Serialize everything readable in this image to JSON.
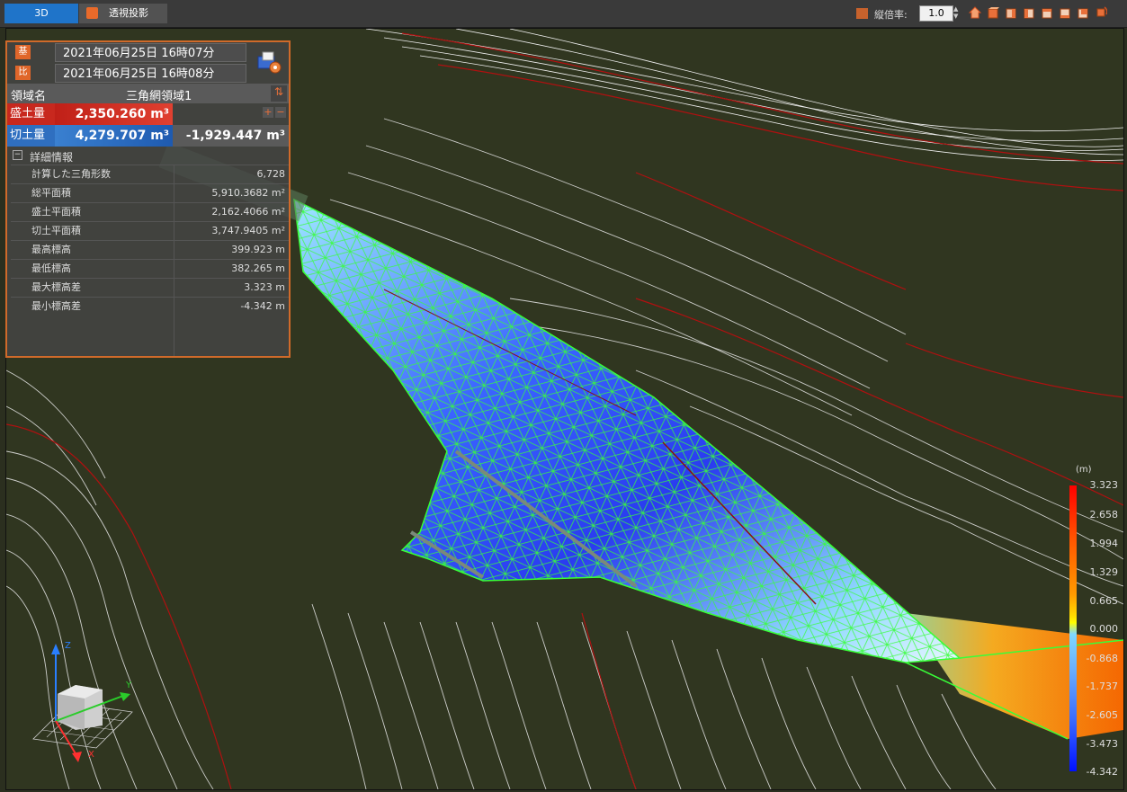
{
  "tabs": [
    {
      "label": "3D",
      "active": true
    },
    {
      "label": "透視投影",
      "active": false
    }
  ],
  "toolbar": {
    "vertical_ratio_label": "縦倍率:",
    "vertical_ratio_value": "1.0",
    "view_icons": [
      "home-icon",
      "front-view-icon",
      "back-view-icon",
      "left-view-icon",
      "right-view-icon",
      "top-view-icon",
      "bottom-view-icon",
      "rotate-view-icon"
    ]
  },
  "panel": {
    "base_badge": "基",
    "base_datetime": "2021年06月25日 16時07分",
    "compare_badge": "比",
    "compare_datetime": "2021年06月25日 16時08分",
    "region_label": "領域名",
    "region_value": "三角網領域1",
    "fill_label": "盛土量",
    "fill_value": "2,350.260 m³",
    "cut_label": "切土量",
    "cut_value": "4,279.707 m³",
    "net_value": "-1,929.447 m³",
    "detail_header": "詳細情報",
    "details": [
      {
        "key": "計算した三角形数",
        "value": "6,728"
      },
      {
        "key": "総平面積",
        "value": "5,910.3682 m²"
      },
      {
        "key": "盛土平面積",
        "value": "2,162.4066 m²"
      },
      {
        "key": "切土平面積",
        "value": "3,747.9405 m²"
      },
      {
        "key": "最高標高",
        "value": "399.923 m"
      },
      {
        "key": "最低標高",
        "value": "382.265 m"
      },
      {
        "key": "最大標高差",
        "value": "3.323 m"
      },
      {
        "key": "最小標高差",
        "value": "-4.342 m"
      }
    ]
  },
  "legend": {
    "unit": "(m)",
    "ticks": [
      "3.323",
      "2.658",
      "1.994",
      "1.329",
      "0.665",
      "0.000",
      "-0.868",
      "-1.737",
      "-2.605",
      "-3.473",
      "-4.342"
    ]
  },
  "axes": {
    "z": "Z",
    "y": "Y",
    "x": "X"
  },
  "colors": {
    "accent": "#e0662a",
    "tab_active": "#1f74c9",
    "fill": "#c0281e",
    "cut": "#2f6fc0",
    "mesh": "#38ff38"
  }
}
